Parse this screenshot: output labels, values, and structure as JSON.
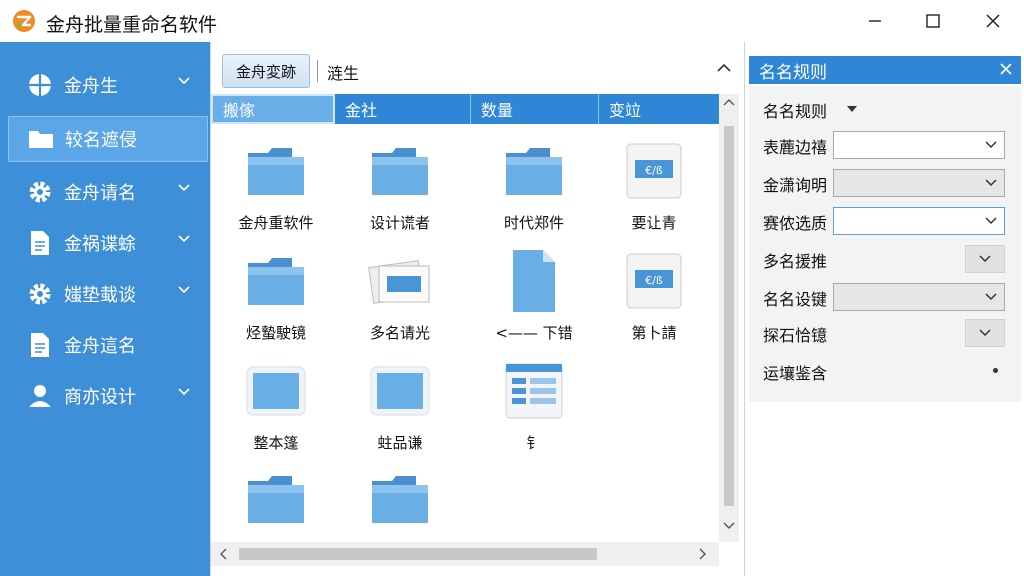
{
  "window": {
    "title": "金舟批量重命名软件"
  },
  "sidebar": {
    "items": [
      {
        "label": "金舟生",
        "icon": "globe-icon",
        "has_chevron": true
      },
      {
        "label": "较名遮侵",
        "icon": "folder-icon",
        "active": true
      },
      {
        "label": "金舟请名",
        "icon": "gear-icon",
        "has_chevron": true
      },
      {
        "label": "金祸谍蜍",
        "icon": "document-icon",
        "has_chevron": true
      },
      {
        "label": "媸垫蛓谈",
        "icon": "gear-icon",
        "has_chevron": true
      },
      {
        "label": "金舟這名",
        "icon": "document-icon"
      },
      {
        "label": "商亦设计",
        "icon": "user-icon",
        "has_chevron": true
      }
    ]
  },
  "toolbar": {
    "button_label": "金舟変跡",
    "path_text": "涟生"
  },
  "columns": [
    {
      "label": "搬傢",
      "selected": true
    },
    {
      "label": "金社"
    },
    {
      "label": "数量"
    },
    {
      "label": "变竝"
    }
  ],
  "files": [
    {
      "label": "金舟重软件",
      "icon": "folder-icon"
    },
    {
      "label": "设计谎者",
      "icon": "folder-icon"
    },
    {
      "label": "时代郑件",
      "icon": "folder-icon"
    },
    {
      "label": "要让青",
      "icon": "file-card-icon"
    },
    {
      "label": "烃蟄駛镜",
      "icon": "folder-icon"
    },
    {
      "label": "多名请光",
      "icon": "stacked-card-icon"
    },
    {
      "label": "<—— 下错",
      "icon": "blank-file-icon"
    },
    {
      "label": "第卜請",
      "icon": "file-card-icon"
    },
    {
      "label": "整本篷",
      "icon": "image-frame-icon"
    },
    {
      "label": "蛀品谦",
      "icon": "image-frame-icon"
    },
    {
      "label": "钅",
      "icon": "app-window-icon"
    },
    {
      "label": "",
      "icon": "folder-icon"
    },
    {
      "label": "",
      "icon": "folder-icon"
    }
  ],
  "rule_panel": {
    "title": "名名规则",
    "rows": [
      {
        "label": "名名规则",
        "control": "dropdown-arrow"
      },
      {
        "label": "表蔍边禧",
        "control": "combo-white"
      },
      {
        "label": "金潇询明",
        "control": "combo-gray"
      },
      {
        "label": "赛侬选质",
        "control": "combo-focus"
      },
      {
        "label": "多名援推",
        "control": "drop-button"
      },
      {
        "label": "名名设键",
        "control": "combo-gray"
      },
      {
        "label": "探石恰镱",
        "control": "drop-button"
      },
      {
        "label": "运壤鉴含",
        "control": "bullet"
      }
    ]
  },
  "colors": {
    "sidebar_bg": "#3d8fd8",
    "header_bg": "#2f86d6",
    "folder_blue": "#5aa0dc"
  }
}
